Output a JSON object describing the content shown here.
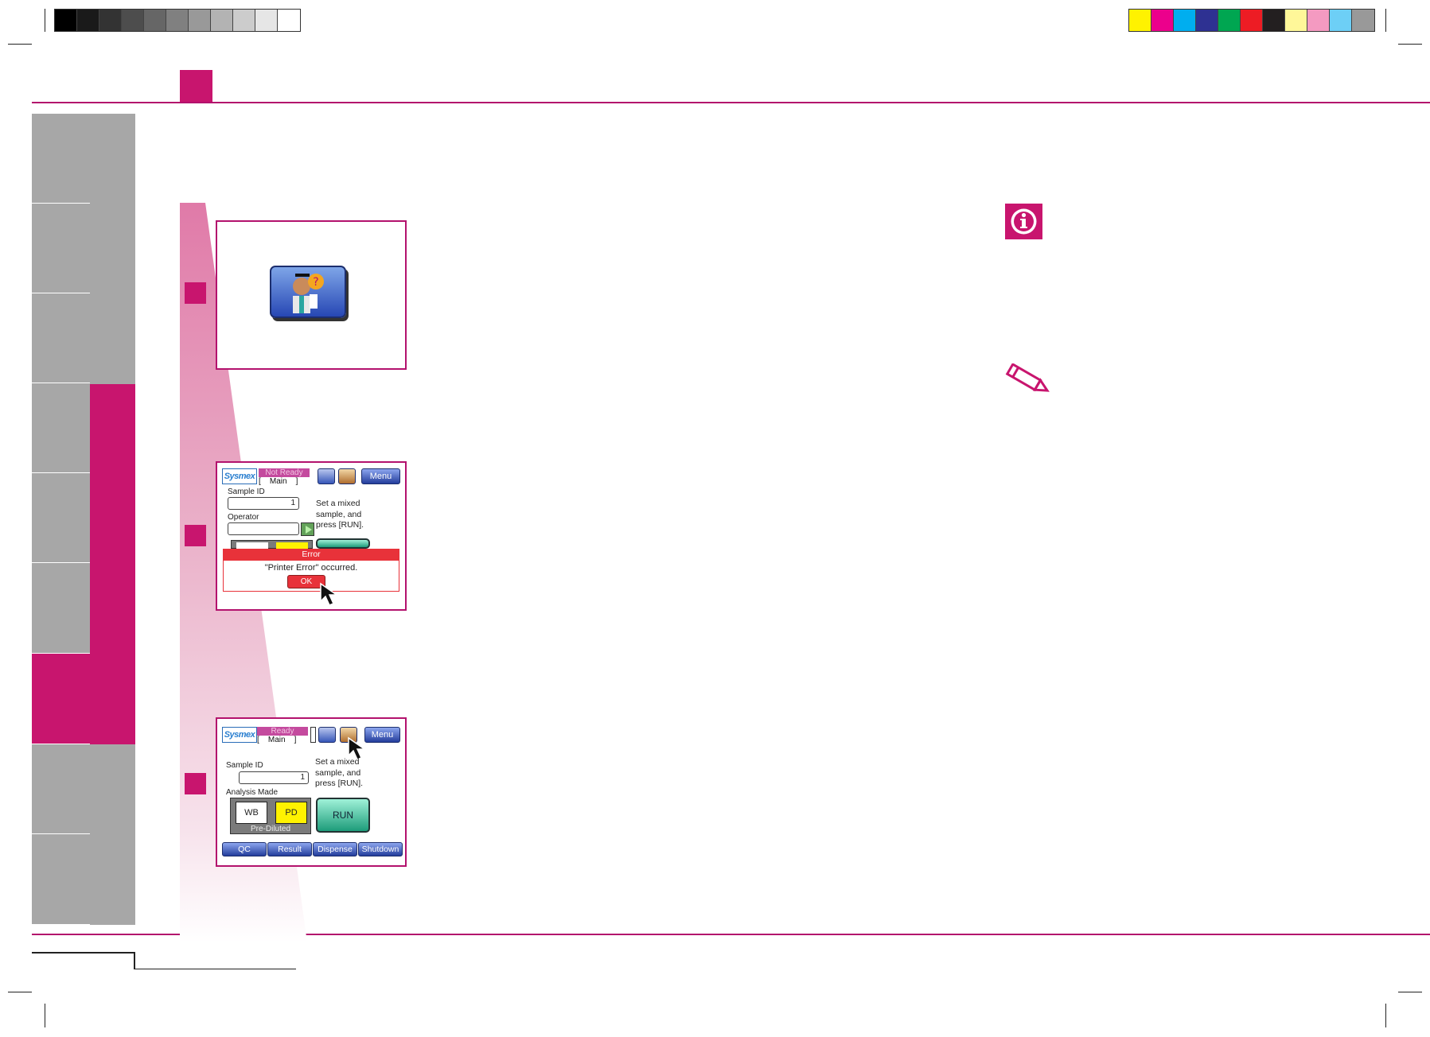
{
  "page": {
    "section_tab_color": "#c8156e"
  },
  "colorbar_gray": [
    "#000000",
    "#1a1a1a",
    "#333333",
    "#4d4d4d",
    "#666666",
    "#808080",
    "#999999",
    "#b3b3b3",
    "#cccccc",
    "#e6e6e6",
    "#ffffff"
  ],
  "colorbar_color": [
    "#fff200",
    "#ec008c",
    "#00aeef",
    "#2e3192",
    "#00a651",
    "#ed1c24",
    "#231f20",
    "#fff799",
    "#f49ac1",
    "#6dcff6",
    "#999999"
  ],
  "screen_error": {
    "logo": "Sysmex",
    "status": "Not Ready",
    "mode_line": "[    Main    ]",
    "menu_label": "Menu",
    "sample_id_label": "Sample ID",
    "sample_id_value": "1",
    "operator_label": "Operator",
    "operator_value": "",
    "message": "Set a mixed\nsample, and\npress [RUN].",
    "error_title": "Error",
    "error_text": "\"Printer Error\" occurred.",
    "ok_label": "OK",
    "help_icon": "help-person-icon",
    "printer_icon": "printer-icon"
  },
  "screen_ready": {
    "logo": "Sysmex",
    "status": "Ready",
    "mode_line": "[    Main    ]",
    "menu_label": "Menu",
    "sample_id_label": "Sample ID",
    "sample_id_value": "1",
    "analysis_mode_label": "Analysis  Made",
    "wb_label": "WB",
    "pd_label": "PD",
    "prediluted_label": "Pre-Diluted",
    "message": "Set a mixed\nsample, and\npress [RUN].",
    "run_label": "RUN",
    "tabs": [
      "QC",
      "Result",
      "Dispense",
      "Shutdown"
    ]
  }
}
